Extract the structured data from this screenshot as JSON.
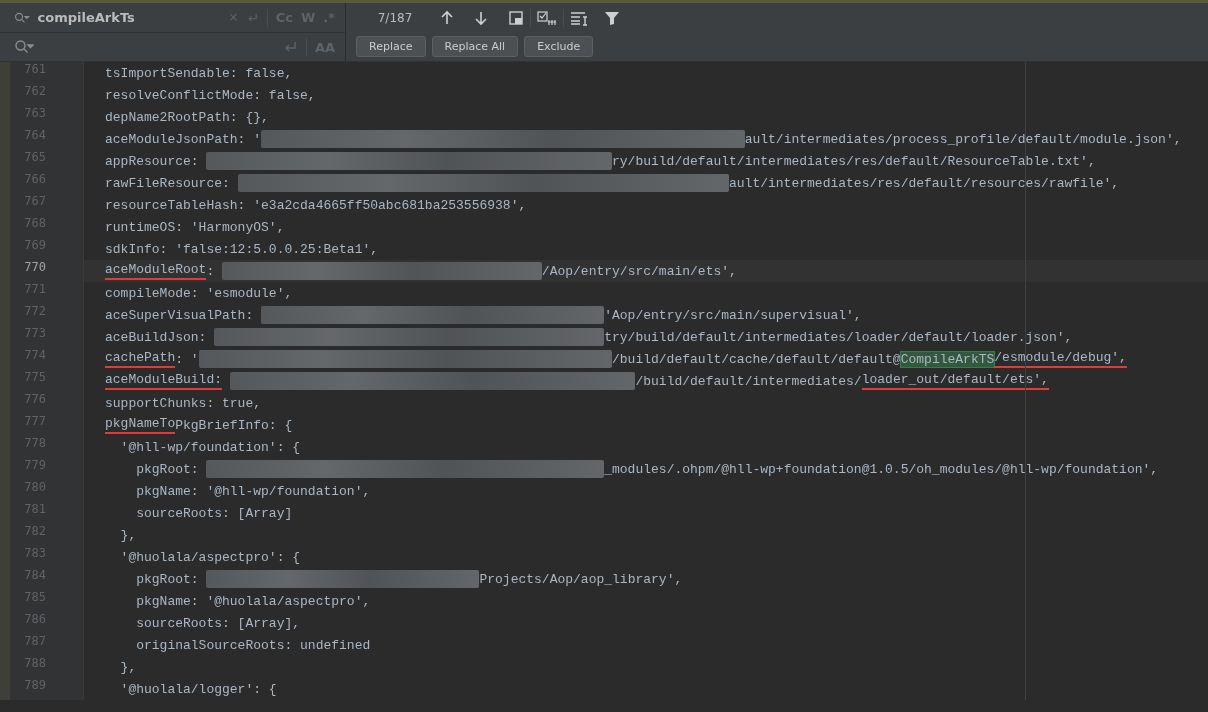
{
  "find_bar": {
    "search": {
      "value": "compileArkTs"
    },
    "search_options": [
      {
        "label": "Cc",
        "on": false
      },
      {
        "label": "W",
        "on": false
      },
      {
        "label": ".*",
        "on": false
      }
    ],
    "match_count": "7/187",
    "replace_options": [
      {
        "label": "AA",
        "on": false
      }
    ],
    "buttons": [
      "Replace",
      "Replace All",
      "Exclude"
    ]
  },
  "editor": {
    "lines": [
      {
        "number": "761",
        "current": false,
        "segments": [
          {
            "kind": "text",
            "text": "tsImportSendable: false,"
          }
        ]
      },
      {
        "number": "762",
        "current": false,
        "segments": [
          {
            "kind": "text",
            "text": "resolveConflictMode: false,"
          }
        ]
      },
      {
        "number": "763",
        "current": false,
        "segments": [
          {
            "kind": "text",
            "text": "depName2RootPath: {},"
          }
        ]
      },
      {
        "number": "764",
        "current": false,
        "segments": [
          {
            "kind": "text",
            "text": "aceModuleJsonPath: '"
          },
          {
            "kind": "blurred"
          },
          {
            "kind": "text",
            "text": "ault/intermediates/process_profile/default/module.json',"
          }
        ]
      },
      {
        "number": "765",
        "current": false,
        "segments": [
          {
            "kind": "text",
            "text": "appResource: "
          },
          {
            "kind": "blurred"
          },
          {
            "kind": "text",
            "text": "ry/build/default/intermediates/res/default/ResourceTable.txt',"
          }
        ]
      },
      {
        "number": "766",
        "current": false,
        "segments": [
          {
            "kind": "text",
            "text": "rawFileResource: "
          },
          {
            "kind": "blurred"
          },
          {
            "kind": "text",
            "text": "ault/intermediates/res/default/resources/rawfile',"
          }
        ]
      },
      {
        "number": "767",
        "current": false,
        "segments": [
          {
            "kind": "text",
            "text": "resourceTableHash: 'e3a2cda4665ff50abc681ba253556938',"
          }
        ]
      },
      {
        "number": "768",
        "current": false,
        "segments": [
          {
            "kind": "text",
            "text": "runtimeOS: 'HarmonyOS',"
          }
        ]
      },
      {
        "number": "769",
        "current": false,
        "segments": [
          {
            "kind": "text",
            "text": "sdkInfo: 'false:12:5.0.0.25:Beta1',"
          }
        ]
      },
      {
        "number": "770",
        "current": true,
        "segments": [
          {
            "kind": "text",
            "text": "aceModuleRoot",
            "underlined": true
          },
          {
            "kind": "text",
            "text": ": "
          },
          {
            "kind": "blurred"
          },
          {
            "kind": "text",
            "text": "/Aop/entry/src/main/ets',"
          }
        ]
      },
      {
        "number": "771",
        "current": false,
        "segments": [
          {
            "kind": "text",
            "text": "compileMode: 'esmodule',"
          }
        ]
      },
      {
        "number": "772",
        "current": false,
        "segments": [
          {
            "kind": "text",
            "text": "aceSuperVisualPath: "
          },
          {
            "kind": "blurred"
          },
          {
            "kind": "text",
            "text": "'Aop/entry/src/main/supervisual',"
          }
        ]
      },
      {
        "number": "773",
        "current": false,
        "segments": [
          {
            "kind": "text",
            "text": "aceBuildJson: "
          },
          {
            "kind": "blurred"
          },
          {
            "kind": "text",
            "text": "try/build/default/intermediates/loader/default/loader.json',"
          }
        ]
      },
      {
        "number": "774",
        "current": false,
        "segments": [
          {
            "kind": "text",
            "text": "cachePath",
            "underlined": true
          },
          {
            "kind": "text",
            "text": ": '"
          },
          {
            "kind": "blurred"
          },
          {
            "kind": "text",
            "text": "/build/default/cache/default/default@"
          },
          {
            "kind": "match",
            "text": "CompileArkTS"
          },
          {
            "kind": "text",
            "text": "/esmodule/debug',",
            "underlined": true
          }
        ]
      },
      {
        "number": "775",
        "current": false,
        "segments": [
          {
            "kind": "text",
            "text": "aceModuleBuild:",
            "underlined": true
          },
          {
            "kind": "blurred"
          },
          {
            "kind": "text",
            "text": "/build/default/intermediates/"
          },
          {
            "kind": "text",
            "text": "loader_out/default/ets',",
            "underlined": true
          }
        ]
      },
      {
        "number": "776",
        "current": false,
        "segments": [
          {
            "kind": "text",
            "text": "supportChunks: true,"
          }
        ]
      },
      {
        "number": "777",
        "current": false,
        "segments": [
          {
            "kind": "text",
            "text": "pkgNameTo",
            "underlined": true
          },
          {
            "kind": "text",
            "text": "PkgBriefInfo: {"
          }
        ]
      },
      {
        "number": "778",
        "current": false,
        "segments": [
          {
            "kind": "text",
            "text": "  '@hll-wp/foundation': {"
          }
        ]
      },
      {
        "number": "779",
        "current": false,
        "segments": [
          {
            "kind": "text",
            "text": "    pkgRoot: "
          },
          {
            "kind": "blurred"
          },
          {
            "kind": "text",
            "text": "_modules/.ohpm/@hll-wp+foundation@1.0.5/oh_modules/@hll-wp/foundation',"
          }
        ]
      },
      {
        "number": "780",
        "current": false,
        "segments": [
          {
            "kind": "text",
            "text": "    pkgName: '@hll-wp/foundation',"
          }
        ]
      },
      {
        "number": "781",
        "current": false,
        "segments": [
          {
            "kind": "text",
            "text": "    sourceRoots: [Array]"
          }
        ]
      },
      {
        "number": "782",
        "current": false,
        "segments": [
          {
            "kind": "text",
            "text": "  },"
          }
        ]
      },
      {
        "number": "783",
        "current": false,
        "segments": [
          {
            "kind": "text",
            "text": "  '@huolala/aspectpro': {"
          }
        ]
      },
      {
        "number": "784",
        "current": false,
        "segments": [
          {
            "kind": "text",
            "text": "    pkgRoot: "
          },
          {
            "kind": "blurred"
          },
          {
            "kind": "text",
            "text": "Projects/Aop/aop_library',"
          }
        ]
      },
      {
        "number": "785",
        "current": false,
        "segments": [
          {
            "kind": "text",
            "text": "    pkgName: '@huolala/aspectpro',"
          }
        ]
      },
      {
        "number": "786",
        "current": false,
        "segments": [
          {
            "kind": "text",
            "text": "    sourceRoots: [Array],"
          }
        ]
      },
      {
        "number": "787",
        "current": false,
        "segments": [
          {
            "kind": "text",
            "text": "    originalSourceRoots: undefined"
          }
        ]
      },
      {
        "number": "788",
        "current": false,
        "segments": [
          {
            "kind": "text",
            "text": "  },"
          }
        ]
      },
      {
        "number": "789",
        "current": false,
        "segments": [
          {
            "kind": "text",
            "text": "  '@huolala/logger': {"
          }
        ]
      }
    ]
  }
}
